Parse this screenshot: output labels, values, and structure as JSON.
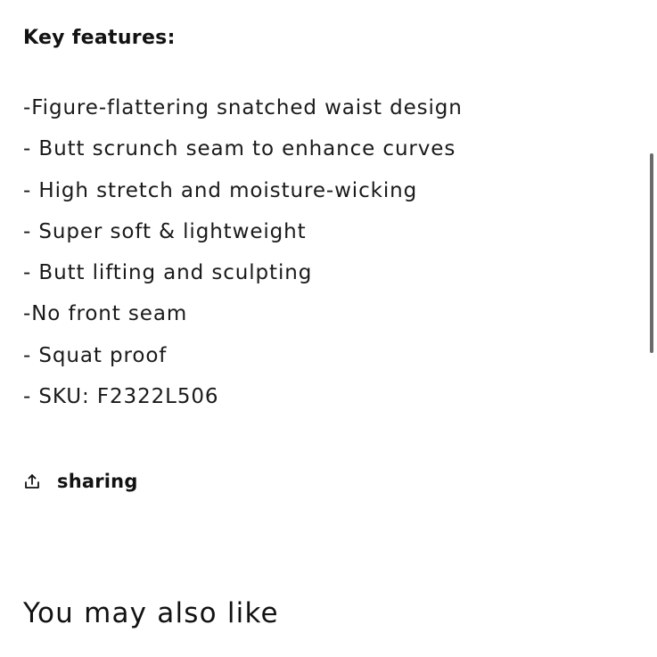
{
  "description": {
    "heading": "Key features:",
    "features": [
      "-Figure-flattering snatched waist design",
      "- Butt scrunch seam to enhance curves",
      "- High stretch and moisture-wicking",
      "- Super soft & lightweight",
      "- Butt lifting and sculpting",
      "-No front seam",
      "- Squat proof",
      "- SKU: F2322L506"
    ]
  },
  "share": {
    "icon": "share-icon",
    "label": "sharing"
  },
  "recommendations": {
    "title": "You may also like"
  },
  "colors": {
    "text": "#121212",
    "scrollbar": "#6b6b6b",
    "background": "#ffffff"
  }
}
